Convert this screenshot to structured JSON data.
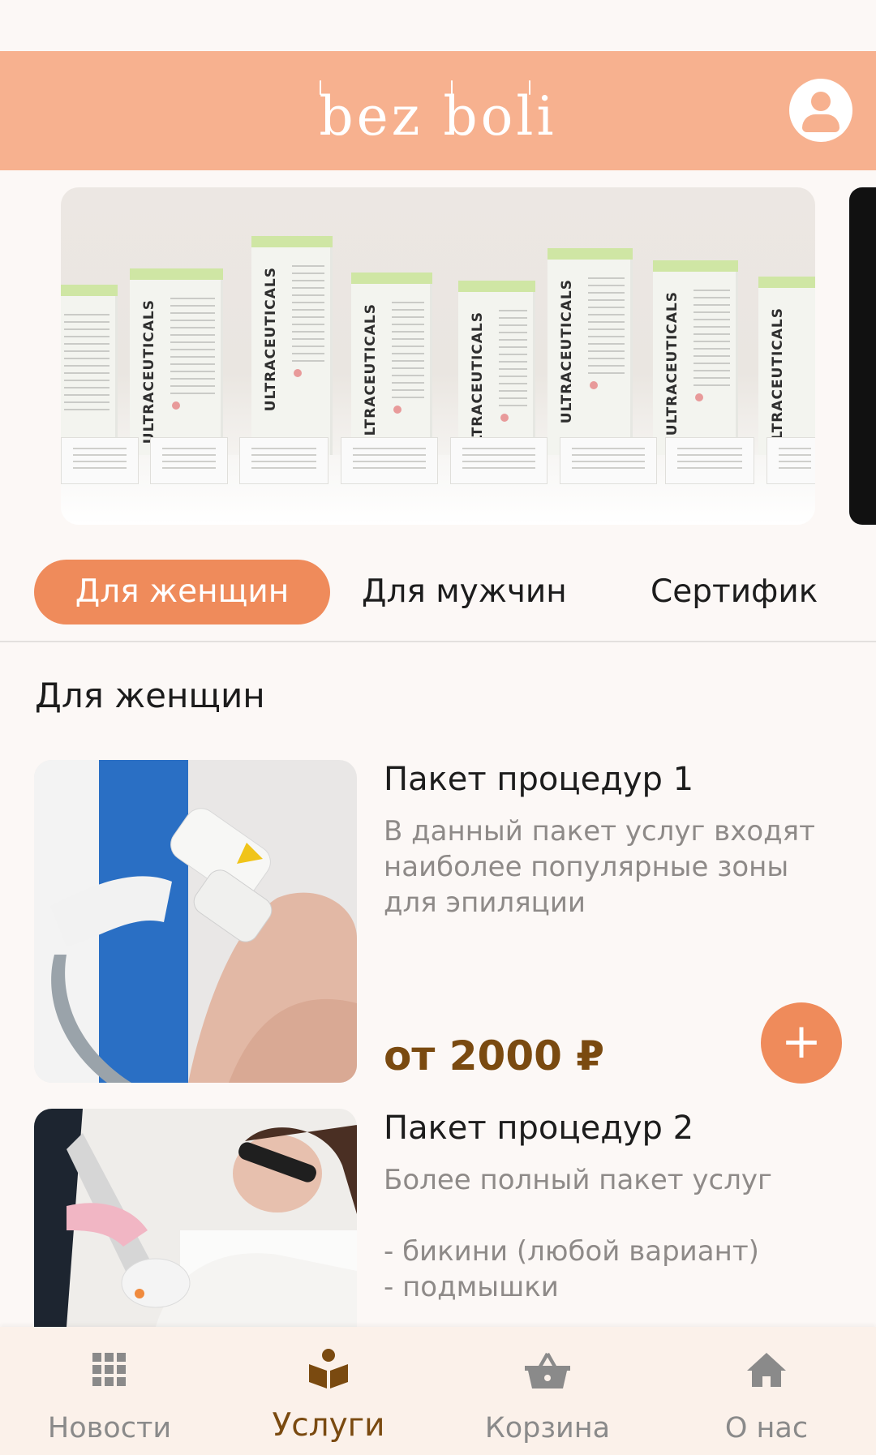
{
  "header": {
    "logo_text": "bez boli"
  },
  "tabs": [
    {
      "label": "Для женщин",
      "active": true
    },
    {
      "label": "Для мужчин",
      "active": false
    },
    {
      "label": "Сертифик",
      "active": false
    }
  ],
  "section_title": "Для женщин",
  "cards": [
    {
      "title": "Пакет процедур 1",
      "description": "В данный пакет услуг входят наиболее популярные зоны для эпиляции",
      "price": "от 2000 ₽",
      "add_label": "+"
    },
    {
      "title": "Пакет процедур 2",
      "description": "Более полный пакет услуг\n\n- бикини (любой вариант)\n- подмышки"
    }
  ],
  "bottom_nav": [
    {
      "label": "Новости",
      "icon": "grid-icon",
      "active": false
    },
    {
      "label": "Услуги",
      "icon": "book-reader-icon",
      "active": true
    },
    {
      "label": "Корзина",
      "icon": "basket-icon",
      "active": false
    },
    {
      "label": "О нас",
      "icon": "home-icon",
      "active": false
    }
  ],
  "colors": {
    "header_bg": "#f7b18f",
    "accent": "#ef8b5b",
    "price": "#7a4a10",
    "muted_text": "#8e8a88",
    "background": "#fcf8f6"
  }
}
